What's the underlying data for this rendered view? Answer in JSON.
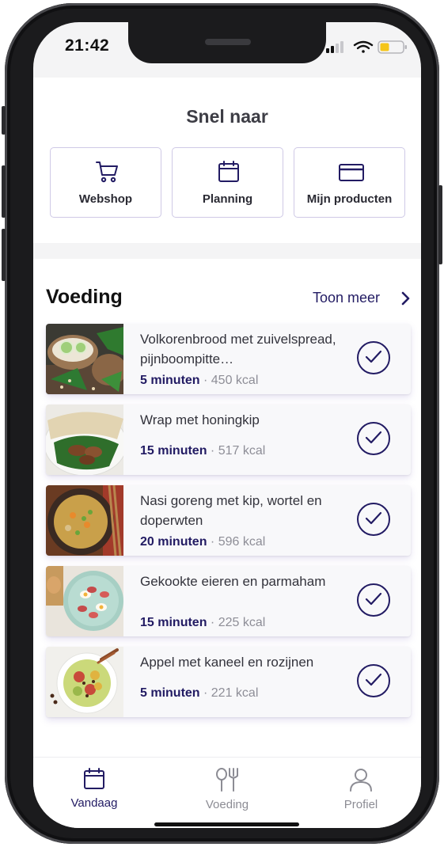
{
  "status_bar": {
    "time": "21:42"
  },
  "quick_links": {
    "title": "Snel naar",
    "items": [
      {
        "label": "Webshop",
        "icon": "cart-icon"
      },
      {
        "label": "Planning",
        "icon": "calendar-icon"
      },
      {
        "label": "Mijn producten",
        "icon": "card-icon"
      }
    ]
  },
  "voeding": {
    "title": "Voeding",
    "more_label": "Toon meer",
    "meals": [
      {
        "title": "Volkorenbrood met zuivelspread, pijnboompitte…",
        "time": "5 minuten",
        "kcal": "450 kcal"
      },
      {
        "title": "Wrap met honingkip",
        "time": "15 minuten",
        "kcal": "517 kcal"
      },
      {
        "title": "Nasi goreng met kip, wortel en doperwten",
        "time": "20 minuten",
        "kcal": "596 kcal"
      },
      {
        "title": "Gekookte eieren en parmaham",
        "time": "15 minuten",
        "kcal": "225 kcal"
      },
      {
        "title": "Appel met kaneel en rozijnen",
        "time": "5 minuten",
        "kcal": "221 kcal"
      }
    ]
  },
  "tabbar": {
    "tabs": [
      {
        "label": "Vandaag",
        "icon": "calendar-icon",
        "active": true
      },
      {
        "label": "Voeding",
        "icon": "cutlery-icon",
        "active": false
      },
      {
        "label": "Profiel",
        "icon": "person-icon",
        "active": false
      }
    ]
  },
  "colors": {
    "accent": "#221b63",
    "tab_active": "#221b63",
    "tab_inactive": "#8c8c94",
    "quick_border": "#cfc9e6"
  }
}
